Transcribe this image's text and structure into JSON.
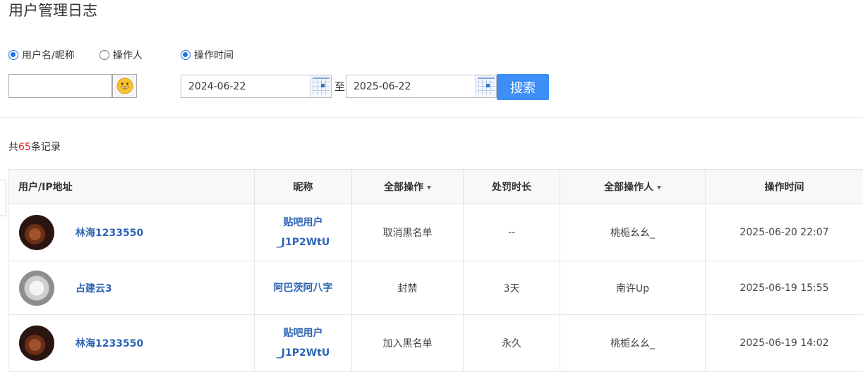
{
  "page": {
    "title": "用户管理日志"
  },
  "filters": {
    "radios": [
      {
        "label": "用户名/昵称",
        "checked": true
      },
      {
        "label": "操作人",
        "checked": false
      },
      {
        "label": "操作时间",
        "checked": true
      }
    ],
    "user_input": {
      "value": "",
      "placeholder": ""
    },
    "date_from": "2024-06-22",
    "date_separator": "至",
    "date_to": "2025-06-22",
    "search_label": "搜索"
  },
  "summary": {
    "prefix": "共",
    "count": "65",
    "suffix": "条记录"
  },
  "table": {
    "headers": {
      "user": "用户/IP地址",
      "nickname": "昵称",
      "operation": "全部操作",
      "duration": "处罚时长",
      "operator": "全部操作人",
      "time": "操作时间"
    },
    "rows": [
      {
        "user": "林海1233550",
        "nickname_line1": "贴吧用户",
        "nickname_line2": "_J1P2WtU",
        "operation": "取消黑名单",
        "duration": "--",
        "operator": "桃栀幺幺_",
        "time": "2025-06-20 22:07",
        "avatar": "violin-avatar"
      },
      {
        "user": "占建云3",
        "nickname_line1": "阿巴茨阿八字",
        "nickname_line2": "",
        "operation": "封禁",
        "duration": "3天",
        "operator": "南许Up",
        "time": "2025-06-19 15:55",
        "avatar": "shoes-avatar"
      },
      {
        "user": "林海1233550",
        "nickname_line1": "贴吧用户",
        "nickname_line2": "_J1P2WtU",
        "operation": "加入黑名单",
        "duration": "永久",
        "operator": "桃栀幺幺_",
        "time": "2025-06-19 14:02",
        "avatar": "violin-avatar"
      }
    ]
  },
  "colors": {
    "accent": "#3e8ef7",
    "link": "#2d64b3",
    "count_red": "#e1251b"
  }
}
